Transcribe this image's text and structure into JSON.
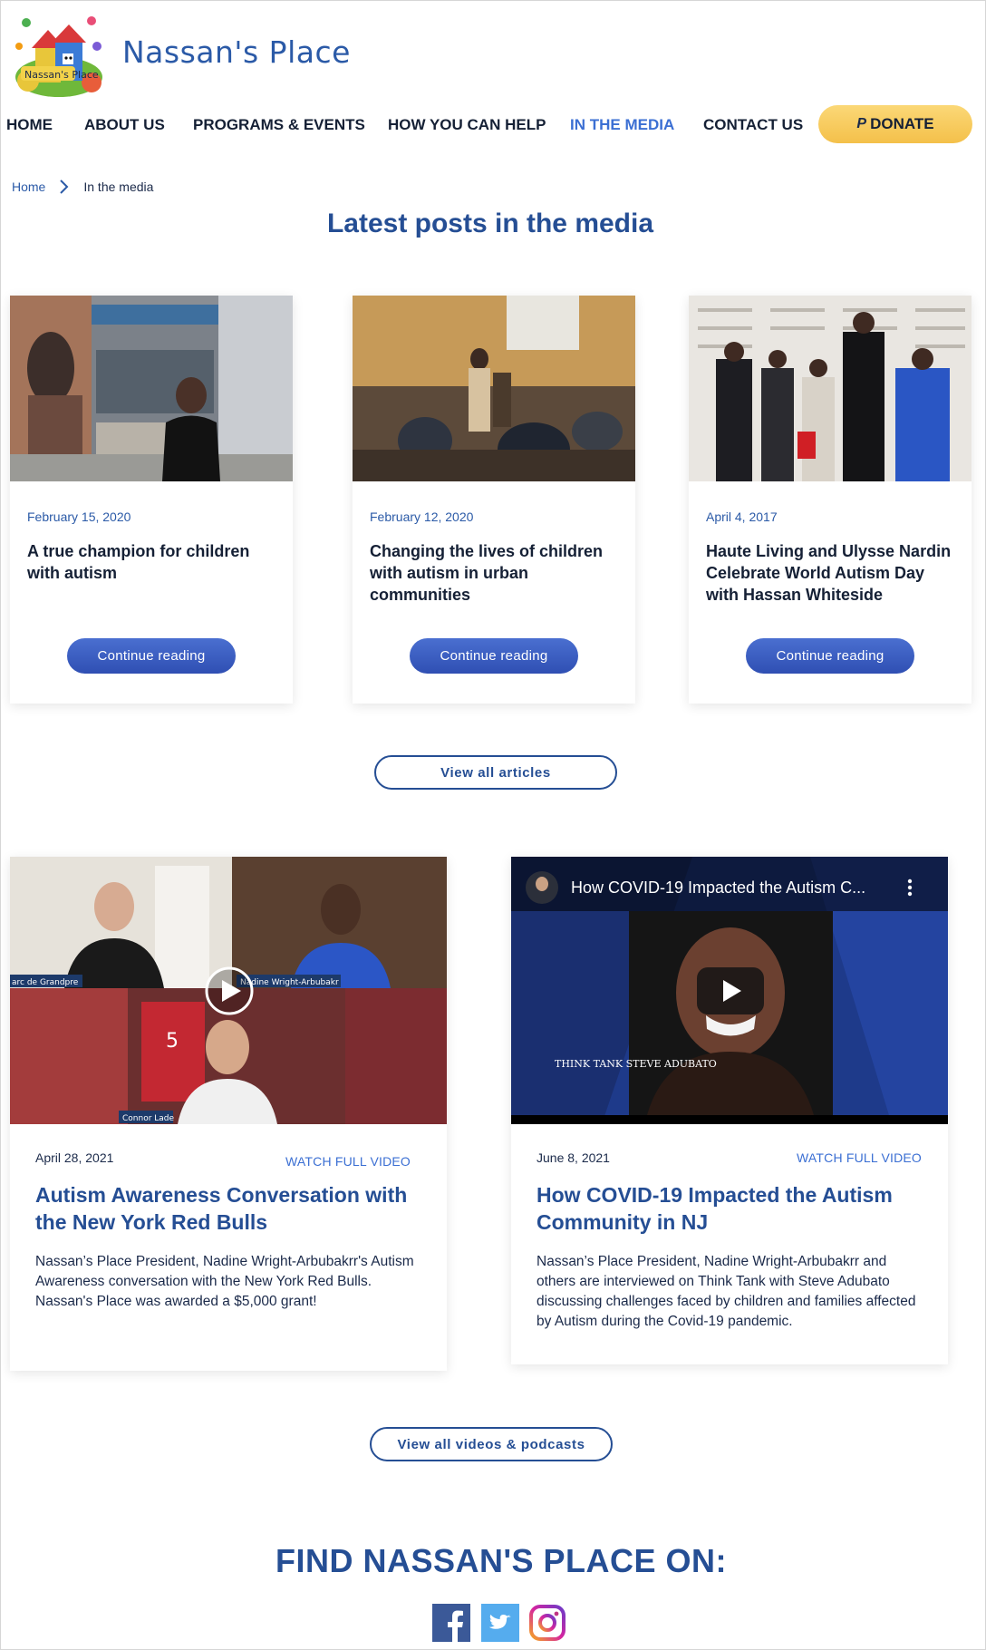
{
  "brand": {
    "name": "Nassan's Place",
    "logo_caption": "Nassan's Place"
  },
  "nav": {
    "items": [
      {
        "label": "HOME"
      },
      {
        "label": "ABOUT US"
      },
      {
        "label": "PROGRAMS & EVENTS"
      },
      {
        "label": "HOW YOU CAN HELP"
      },
      {
        "label": "IN THE MEDIA",
        "active": true
      },
      {
        "label": "CONTACT US"
      }
    ],
    "donate_label": "DONATE",
    "donate_icon": "paypal-icon"
  },
  "breadcrumb": {
    "home": "Home",
    "current": "In the media"
  },
  "latest": {
    "title": "Latest posts in the media",
    "articles": [
      {
        "date": "February 15, 2020",
        "title": "A true champion for children with autism",
        "cta": "Continue reading"
      },
      {
        "date": "February 12, 2020",
        "title": "Changing the lives of children with autism in urban communities",
        "cta": "Continue reading"
      },
      {
        "date": "April 4, 2017",
        "title": "Haute Living and Ulysse Nardin Celebrate World Autism Day with Hassan Whiteside",
        "cta": "Continue reading"
      }
    ],
    "view_all": "View all articles"
  },
  "videos": {
    "items": [
      {
        "date": "April 28, 2021",
        "watch": "WATCH FULL VIDEO",
        "title": "Autism Awareness Conversation with the New York Red Bulls",
        "description": "Nassan’s Place President, Nadine Wright-Arbubakrr's Autism Awareness conversation with the New York Red Bulls.  Nassan's Place was awarded a $5,000 grant!",
        "thumb_labels": [
          "arc de Grandpre",
          "Nadine Wright-Arbubakr",
          "Connor Lade"
        ],
        "thumb_jersey": "5"
      },
      {
        "date": "June 8, 2021",
        "watch": "WATCH FULL VIDEO",
        "title": "How COVID-19 Impacted the Autism Community in NJ",
        "description": "Nassan’s Place President, Nadine Wright-Arbubakrr and others are interviewed on Think Tank with Steve Adubato discussing challenges faced by children and families affected by Autism during the Covid-19 pandemic.",
        "player_title": "How COVID-19 Impacted the Autism C...",
        "watermark": "THINK TANK STEVE ADUBATO"
      }
    ],
    "view_all": "View all videos & podcasts"
  },
  "social": {
    "title": "FIND NASSAN'S PLACE ON:",
    "icons": [
      "facebook-icon",
      "twitter-icon",
      "instagram-icon"
    ],
    "colors": {
      "facebook": "#3b5998",
      "twitter": "#55acee",
      "instagram": "#c13584"
    }
  },
  "colors": {
    "brand_blue": "#254e94",
    "accent": "#3b6fd3",
    "donate": "#f4c04a",
    "button": "#3553bf"
  }
}
